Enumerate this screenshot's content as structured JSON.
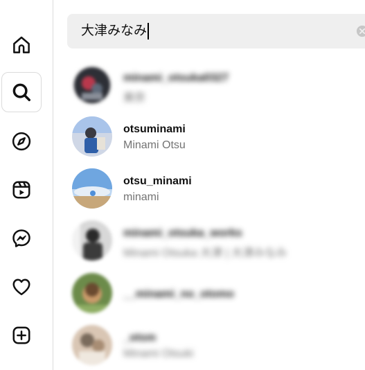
{
  "sidebar": {
    "items": [
      {
        "name": "home-icon"
      },
      {
        "name": "search-icon",
        "active": true
      },
      {
        "name": "explore-compass-icon"
      },
      {
        "name": "reels-icon"
      },
      {
        "name": "messenger-icon"
      },
      {
        "name": "heart-icon"
      },
      {
        "name": "create-plus-icon"
      }
    ]
  },
  "search": {
    "query": "大津みなみ",
    "clear_icon": "clear-circle-icon"
  },
  "results": [
    {
      "username": "minami_otsuka0327",
      "fullname": "美奈",
      "blurred": true,
      "colors": [
        "#2d2f36",
        "#b9384c"
      ]
    },
    {
      "username": "otsuminami",
      "fullname": "Minami Otsu",
      "blurred": false,
      "colors": [
        "#2f5fa8",
        "#cfd7e6"
      ]
    },
    {
      "username": "otsu_minami",
      "fullname": "minami",
      "blurred": false,
      "colors": [
        "#4f8fd9",
        "#c7a77a"
      ]
    },
    {
      "username": "minami_otsuka_works",
      "fullname": "Minami Otsuka 大津 | 大津みなみ",
      "blurred": true,
      "colors": [
        "#2a2a2a",
        "#d8d8d8"
      ]
    },
    {
      "username": "__minami_no_otomo",
      "fullname": "",
      "blurred": true,
      "colors": [
        "#6c8b4a",
        "#c99a6a"
      ]
    },
    {
      "username": "_otsm",
      "fullname": "Minami Otsuki",
      "blurred": true,
      "colors": [
        "#7a6b5c",
        "#d9c6b4"
      ]
    }
  ]
}
